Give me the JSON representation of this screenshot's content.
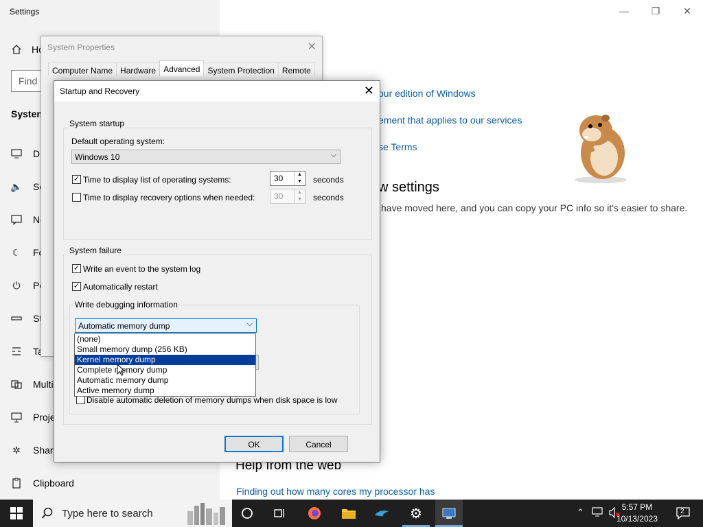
{
  "settings": {
    "window_title": "Settings",
    "controls": {
      "minimize": "—",
      "restore": "❐",
      "close": "✕"
    },
    "home_label": "Home",
    "search_placeholder": "Find a setting",
    "section": "System",
    "side_items": [
      {
        "icon": "display-icon",
        "label": "Display"
      },
      {
        "icon": "sound-icon",
        "label": "Sound"
      },
      {
        "icon": "notifications-icon",
        "label": "Notifications & actions"
      },
      {
        "icon": "focus-icon",
        "label": "Focus assist"
      },
      {
        "icon": "power-icon",
        "label": "Power & sleep"
      },
      {
        "icon": "storage-icon",
        "label": "Storage"
      },
      {
        "icon": "tablet-icon",
        "label": "Tablet"
      },
      {
        "icon": "multitasking-icon",
        "label": "Multitasking"
      },
      {
        "icon": "projecting-icon",
        "label": "Projecting to this PC"
      },
      {
        "icon": "shared-icon",
        "label": "Shared experiences"
      },
      {
        "icon": "clipboard-icon",
        "label": "Clipboard"
      }
    ],
    "side_visible": [
      "Di",
      "So",
      "No",
      "Fo",
      "Po",
      "St",
      "Ta",
      "Multi",
      "Proje",
      "Share",
      "Clipboard"
    ],
    "home_visible": "Ho",
    "search_visible": "Find",
    "main": {
      "link1": "our edition of Windows",
      "link2": "ement that applies to our services",
      "link3": "se Terms",
      "heading": "w settings",
      "text": "have moved here, and you can copy your PC info so it's easier to share.",
      "help_heading": "Help from the web",
      "help_link": "Finding out how many cores my processor has"
    }
  },
  "system_properties": {
    "title": "System Properties",
    "close": "✕",
    "tabs": [
      "Computer Name",
      "Hardware",
      "Advanced",
      "System Protection",
      "Remote"
    ],
    "active_tab": "Advanced"
  },
  "startup_recovery": {
    "title": "Startup and Recovery",
    "close": "✕",
    "system_startup": {
      "group_label": "System startup",
      "default_os_label": "Default operating system:",
      "default_os_value": "Windows 10",
      "display_list_label": "Time to display list of operating systems:",
      "display_list_checked": true,
      "display_list_value": "30",
      "display_list_unit": "seconds",
      "recovery_label": "Time to display recovery options when needed:",
      "recovery_checked": false,
      "recovery_value": "30",
      "recovery_unit": "seconds"
    },
    "system_failure": {
      "group_label": "System failure",
      "write_event_label": "Write an event to the system log",
      "write_event_checked": true,
      "auto_restart_label": "Automatically restart",
      "auto_restart_checked": true,
      "debug_group_label": "Write debugging information",
      "debug_value": "Automatic memory dump",
      "dropdown_options": [
        "(none)",
        "Small memory dump (256 KB)",
        "Kernel memory dump",
        "Complete memory dump",
        "Automatic memory dump",
        "Active memory dump"
      ],
      "highlighted_option": "Kernel memory dump",
      "disable_deletion_label": "Disable automatic deletion of memory dumps when disk space is low",
      "disable_deletion_checked": false
    },
    "ok_label": "OK",
    "cancel_label": "Cancel"
  },
  "taskbar": {
    "search_placeholder": "Type here to search",
    "time": "5:57 PM",
    "date": "10/13/2023",
    "notification_count": "2"
  },
  "colors": {
    "accent": "#0078d7",
    "link": "#0b5ea8",
    "selection": "#003c9c",
    "taskbar": "#1f1f1f"
  }
}
